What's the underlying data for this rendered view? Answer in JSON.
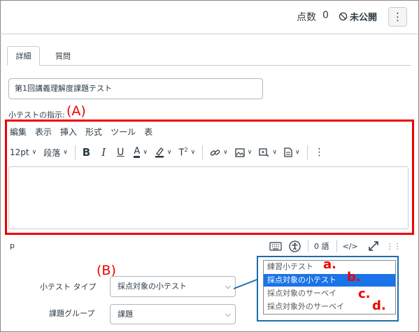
{
  "header": {
    "points_label": "点数",
    "points_value": "0",
    "publish_status": "未公開",
    "kebab_label": "⋮"
  },
  "tabs": [
    {
      "label": "詳細"
    },
    {
      "label": "質問"
    }
  ],
  "quiz_title": "第1回講義理解度課題テスト",
  "instructions_label": "小テストの指示:",
  "annotations": {
    "a": "(A)",
    "b": "(B)"
  },
  "editor": {
    "menu": [
      "編集",
      "表示",
      "挿入",
      "形式",
      "ツール",
      "表"
    ],
    "font_size": "12pt",
    "paragraph": "段落",
    "status_path": "p",
    "word_count": "0 語",
    "html_toggle": "</>"
  },
  "form": {
    "quiz_type_label": "小テスト タイプ",
    "quiz_type_value": "採点対象の小テスト",
    "group_label": "課題グループ",
    "group_value": "課題"
  },
  "quiz_type_options": [
    {
      "label": "練習小テスト",
      "marker": "a.",
      "selected": false
    },
    {
      "label": "採点対象の小テスト",
      "marker": "b.",
      "selected": true
    },
    {
      "label": "採点対象のサーベイ",
      "marker": "c.",
      "selected": false
    },
    {
      "label": "採点対象外のサーベイ",
      "marker": "d.",
      "selected": false
    }
  ],
  "colors": {
    "annotation_red": "#e00000",
    "callout_blue": "#1a6db0",
    "selected_option": "#1a73e8"
  }
}
